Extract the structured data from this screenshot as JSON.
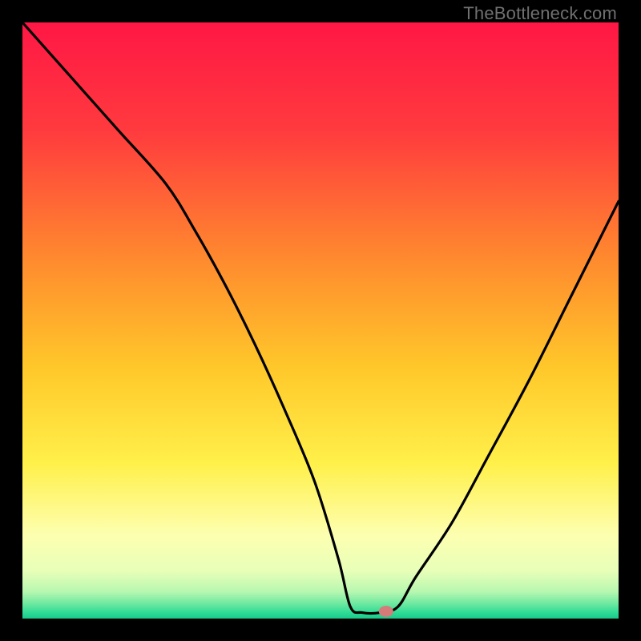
{
  "watermark": "TheBottleneck.com",
  "chart_data": {
    "type": "line",
    "title": "",
    "xlabel": "",
    "ylabel": "",
    "xlim": [
      0,
      100
    ],
    "ylim": [
      0,
      100
    ],
    "curve": {
      "name": "bottleneck-curve",
      "x": [
        0,
        8,
        16,
        24,
        29,
        34,
        39,
        44,
        49,
        53,
        55,
        57,
        60,
        63,
        66,
        72,
        78,
        85,
        92,
        100
      ],
      "y": [
        100,
        91,
        82,
        73,
        65,
        56,
        46,
        35,
        23,
        10,
        2,
        1,
        1,
        2,
        7,
        16,
        27,
        40,
        54,
        70
      ]
    },
    "marker": {
      "x": 61,
      "y": 1.2,
      "color": "#d77a7a"
    },
    "gradient_stops": [
      {
        "pos": 0.0,
        "color": "#ff1745"
      },
      {
        "pos": 0.18,
        "color": "#ff3a3e"
      },
      {
        "pos": 0.4,
        "color": "#ff8b2e"
      },
      {
        "pos": 0.58,
        "color": "#ffc82a"
      },
      {
        "pos": 0.74,
        "color": "#fff04a"
      },
      {
        "pos": 0.86,
        "color": "#fdffb0"
      },
      {
        "pos": 0.92,
        "color": "#e8ffb8"
      },
      {
        "pos": 0.955,
        "color": "#b7f7b0"
      },
      {
        "pos": 0.975,
        "color": "#6ee8a0"
      },
      {
        "pos": 0.99,
        "color": "#2fdc95"
      },
      {
        "pos": 1.0,
        "color": "#18c98b"
      }
    ]
  }
}
